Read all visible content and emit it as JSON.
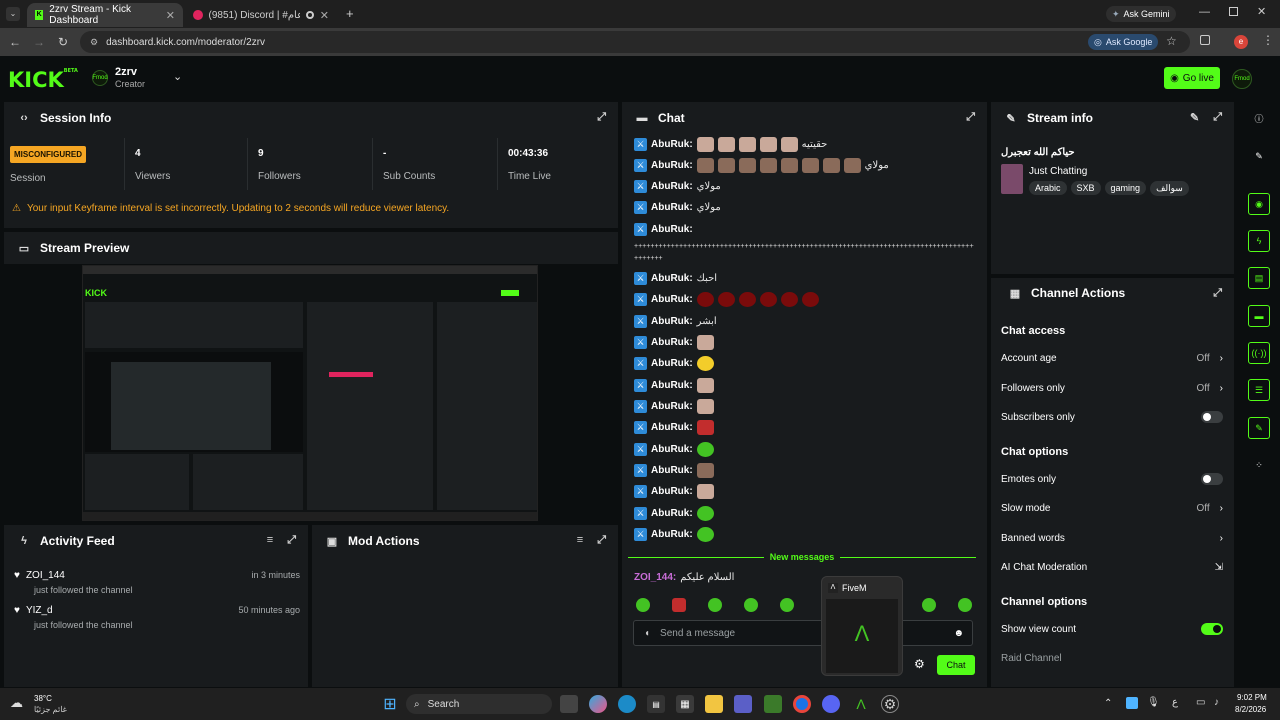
{
  "browser": {
    "tabs": [
      {
        "label": "2zrv Stream - Kick Dashboard",
        "active": true
      },
      {
        "label": "(9851) Discord | #شات-عام",
        "active": false
      }
    ],
    "ask_gemini": "Ask Gemini",
    "url": "dashboard.kick.com/moderator/2zrv",
    "ask_google": "Ask Google",
    "profile_initial": "e"
  },
  "header": {
    "logo": "KICK",
    "logo_sup": "BETA",
    "channel": "2zrv",
    "role": "Creator",
    "avatar_text": "Fmod",
    "go_live": "Go live"
  },
  "session": {
    "title": "Session Info",
    "badge": "MISCONFIGURED",
    "session_label": "Session",
    "stats": [
      {
        "value": "4",
        "label": "Viewers"
      },
      {
        "value": "9",
        "label": "Followers"
      },
      {
        "value": "-",
        "label": "Sub Counts"
      },
      {
        "value": "00:43:36",
        "label": "Time Live"
      }
    ],
    "warning": "Your input Keyframe interval is set incorrectly. Updating to 2 seconds will reduce viewer latency."
  },
  "preview": {
    "title": "Stream Preview"
  },
  "activity": {
    "title": "Activity Feed",
    "items": [
      {
        "user": "ZOI_144",
        "text": "just followed the channel",
        "time": "in 3 minutes"
      },
      {
        "user": "YIZ_d",
        "text": "just followed the channel",
        "time": "50 minutes ago"
      }
    ]
  },
  "mod_actions": {
    "title": "Mod Actions"
  },
  "chat": {
    "title": "Chat",
    "username": "AbuRuk:",
    "messages": [
      {
        "text": "حقيتيه",
        "emotes": [
          "cat",
          "cat",
          "cat",
          "cat",
          "cat"
        ]
      },
      {
        "text": "مولاي",
        "emotes": [
          "hat",
          "hat",
          "hat",
          "hat",
          "hat",
          "hat",
          "hat",
          "hat"
        ]
      },
      {
        "text": "مولاي",
        "emotes": []
      },
      {
        "text": "مولاي",
        "emotes": []
      },
      {
        "text": "",
        "emotes": []
      },
      {
        "text": "احبك",
        "emotes": []
      },
      {
        "text": "",
        "emotes": [
          "red",
          "red",
          "red",
          "red",
          "red",
          "red"
        ]
      },
      {
        "text": "ابشر",
        "emotes": []
      },
      {
        "text": "",
        "emotes": [
          "cat"
        ]
      },
      {
        "text": "",
        "emotes": [
          "yellow"
        ]
      },
      {
        "text": "",
        "emotes": [
          "cat"
        ]
      },
      {
        "text": "",
        "emotes": [
          "cat"
        ]
      },
      {
        "text": "",
        "emotes": [
          "redsq"
        ]
      },
      {
        "text": "",
        "emotes": [
          "green"
        ]
      },
      {
        "text": "",
        "emotes": [
          "hat"
        ]
      },
      {
        "text": "",
        "emotes": [
          "cat"
        ]
      },
      {
        "text": "",
        "emotes": [
          "green"
        ]
      },
      {
        "text": "",
        "emotes": [
          "green"
        ]
      }
    ],
    "long_line": "++++++++++++++++++++++++++++++++++++++++++++++++++++++++++++++++++++++++++++++++++++++++++++++++++",
    "long_line2": "+++++++",
    "new_messages": "New messages",
    "last_user": "ZOI_144:",
    "last_text": "السلام عليكم",
    "placeholder": "Send a message",
    "chat_button": "Chat"
  },
  "popup": {
    "title": "FiveM"
  },
  "stream_info": {
    "title": "Stream info",
    "stream_title": "حياكم الله تعجبرل",
    "category": "Just Chatting",
    "tags": [
      "Arabic",
      "SXB",
      "gaming",
      "سوالف"
    ]
  },
  "channel_actions": {
    "title": "Channel Actions",
    "sections": [
      {
        "heading": "Chat access",
        "rows": [
          {
            "label": "Account age",
            "value": "Off",
            "kind": "chevron"
          },
          {
            "label": "Followers only",
            "value": "Off",
            "kind": "chevron"
          },
          {
            "label": "Subscribers only",
            "value": "",
            "kind": "toggle-off"
          }
        ]
      },
      {
        "heading": "Chat options",
        "rows": [
          {
            "label": "Emotes only",
            "value": "",
            "kind": "toggle-off"
          },
          {
            "label": "Slow mode",
            "value": "Off",
            "kind": "chevron"
          },
          {
            "label": "Banned words",
            "value": "",
            "kind": "chevron"
          },
          {
            "label": "AI Chat Moderation",
            "value": "",
            "kind": "external"
          }
        ]
      },
      {
        "heading": "Channel options",
        "rows": [
          {
            "label": "Show view count",
            "value": "",
            "kind": "toggle-on"
          },
          {
            "label": "Raid Channel",
            "value": "",
            "kind": "none"
          }
        ]
      }
    ]
  },
  "taskbar": {
    "weather_temp": "38°C",
    "weather_text": "غائم جزئيًا",
    "search": "Search",
    "lang": "ع",
    "time": "9:02 PM",
    "date": "8/2/2026"
  },
  "colors": {
    "accent": "#53fc18",
    "warning": "#f5a623",
    "panel": "#181b1d"
  }
}
